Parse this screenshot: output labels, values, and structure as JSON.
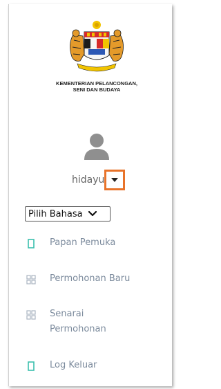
{
  "ministry": {
    "line1": "KEMENTERIAN PELANCONGAN,",
    "line2": "SENI DAN BUDAYA"
  },
  "user": {
    "name": "hidayu"
  },
  "language": {
    "selected": "Pilih Bahasa"
  },
  "menu": [
    {
      "label": "Papan Pemuka",
      "icon": "bookmark-icon"
    },
    {
      "label": "Permohonan Baru",
      "icon": "grid-icon"
    },
    {
      "label": "Senarai Permohonan",
      "icon": "grid-icon"
    },
    {
      "label": "Log Keluar",
      "icon": "bookmark-icon"
    }
  ],
  "colors": {
    "accent_teal": "#3bbfad",
    "menu_text": "#7b8a9c",
    "highlight_border": "#e8732a"
  }
}
